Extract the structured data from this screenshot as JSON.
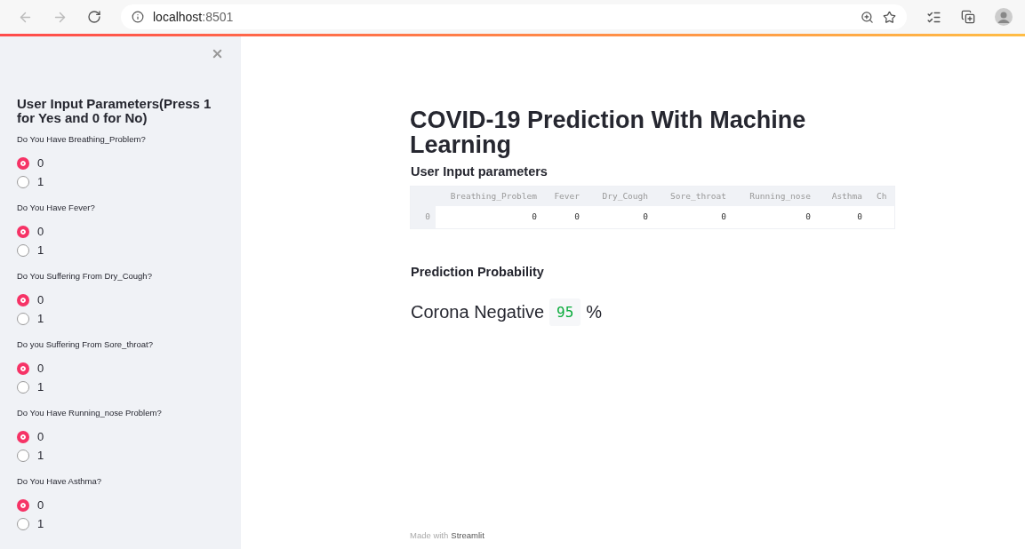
{
  "browser": {
    "url_host": "localhost",
    "url_port": ":8501"
  },
  "sidebar": {
    "title": "User Input Parameters(Press 1 for Yes and 0 for No)",
    "questions": [
      {
        "label": "Do You Have Breathing_Problem?",
        "options": [
          {
            "label": "0",
            "selected": true
          },
          {
            "label": "1",
            "selected": false
          }
        ]
      },
      {
        "label": "Do You Have Fever?",
        "options": [
          {
            "label": "0",
            "selected": true
          },
          {
            "label": "1",
            "selected": false
          }
        ]
      },
      {
        "label": "Do You Suffering From Dry_Cough?",
        "options": [
          {
            "label": "0",
            "selected": true
          },
          {
            "label": "1",
            "selected": false
          }
        ]
      },
      {
        "label": "Do you Suffering From Sore_throat?",
        "options": [
          {
            "label": "0",
            "selected": true
          },
          {
            "label": "1",
            "selected": false
          }
        ]
      },
      {
        "label": "Do You Have Running_nose Problem?",
        "options": [
          {
            "label": "0",
            "selected": true
          },
          {
            "label": "1",
            "selected": false
          }
        ]
      },
      {
        "label": "Do You Have Asthma?",
        "options": [
          {
            "label": "0",
            "selected": true
          },
          {
            "label": "1",
            "selected": false
          }
        ]
      }
    ]
  },
  "main": {
    "title": "COVID-19 Prediction With Machine Learning",
    "input_heading": "User Input parameters",
    "table": {
      "columns": [
        "Breathing_Problem",
        "Fever",
        "Dry_Cough",
        "Sore_throat",
        "Running_nose",
        "Asthma",
        "Ch"
      ],
      "rows": [
        {
          "index": "0",
          "cells": [
            "0",
            "0",
            "0",
            "0",
            "0",
            "0"
          ]
        }
      ]
    },
    "prediction_heading": "Prediction Probability",
    "result_label": "Corona Negative",
    "result_value": "95",
    "result_unit": "%"
  },
  "footer": {
    "text": "Made with",
    "link": "Streamlit"
  }
}
